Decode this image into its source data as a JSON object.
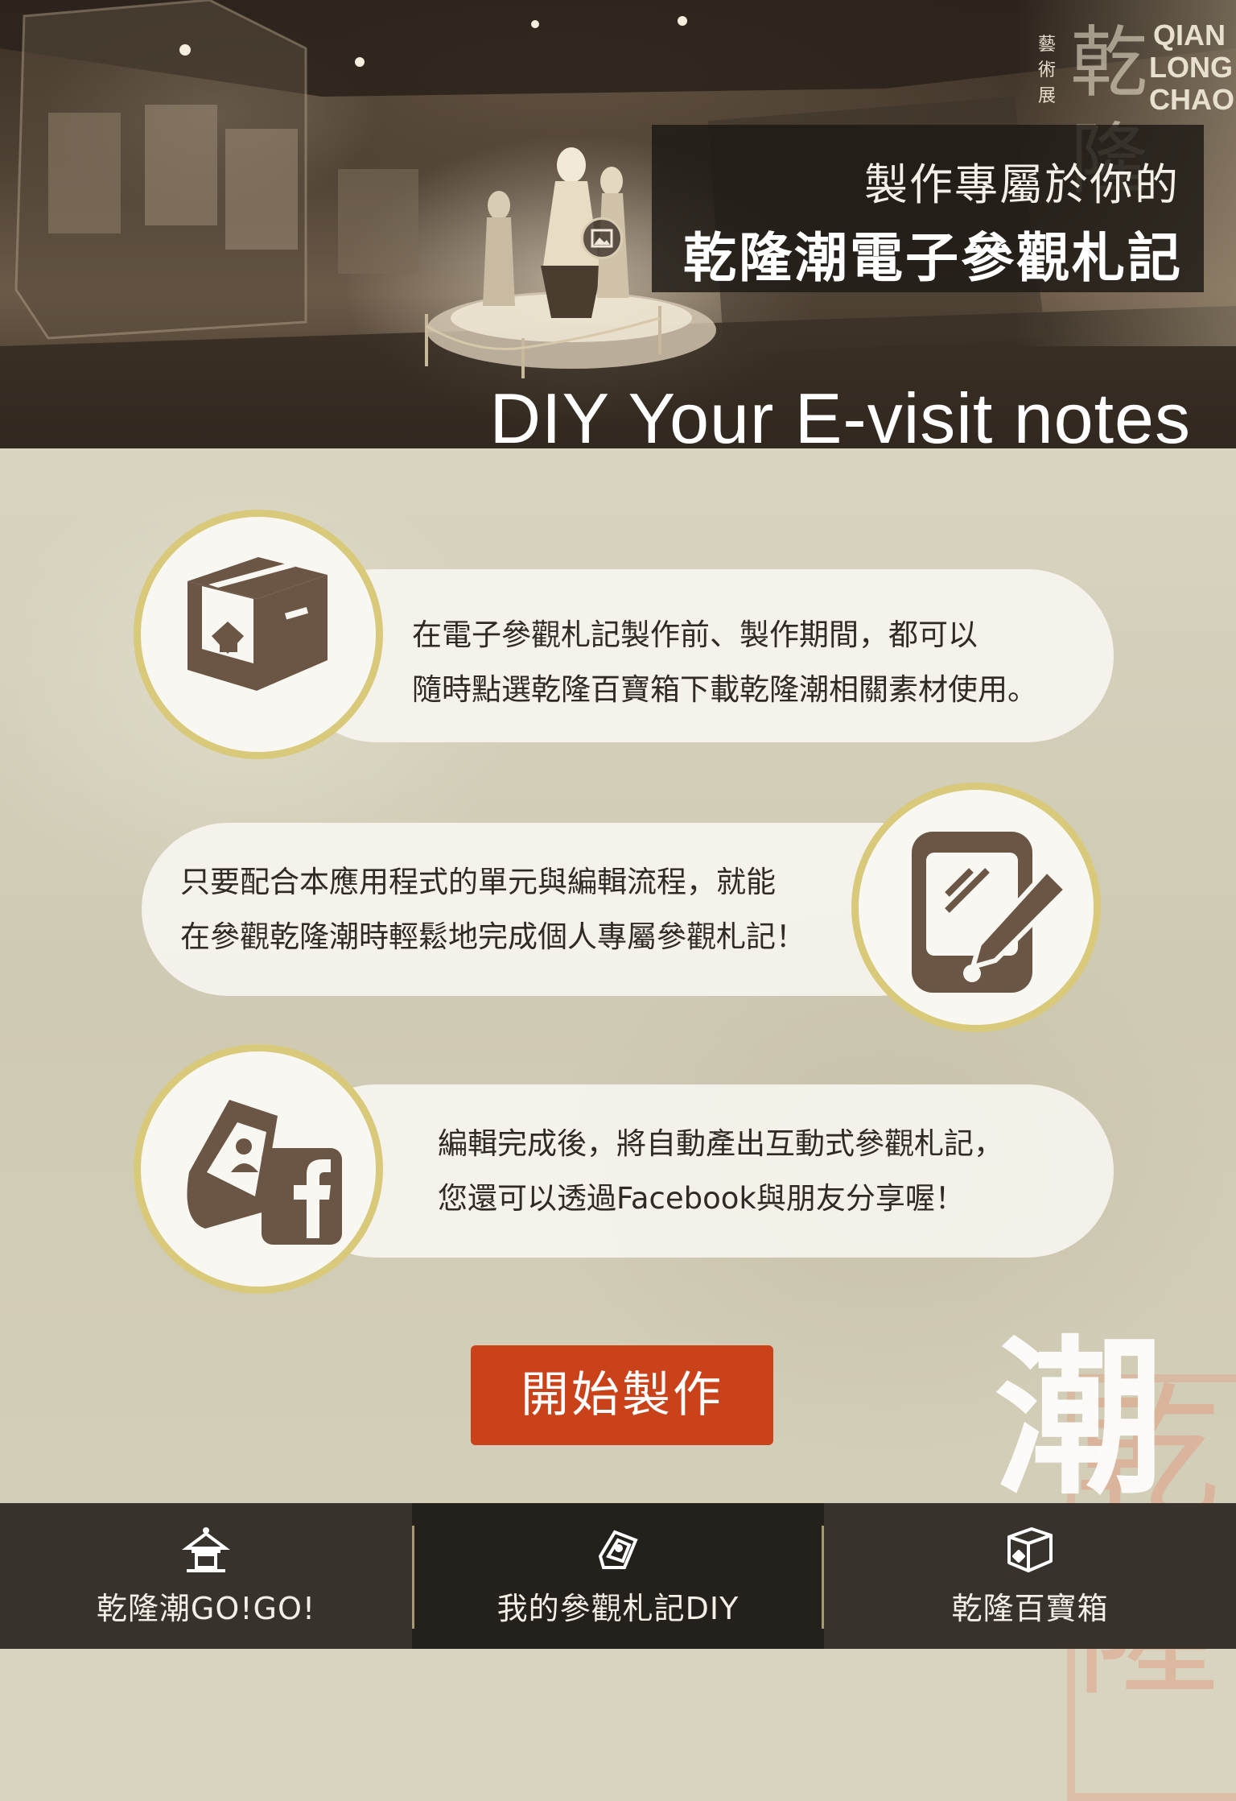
{
  "hero": {
    "subtitle": "製作專屬於你的",
    "title": "乾隆潮電子參觀札記",
    "english_title": "DIY Your E-visit notes",
    "banner_en": "QIAN LONG CHAO",
    "banner_vertical": "藝術展",
    "banner_char_1": "乾",
    "banner_char_2": "隆",
    "photo_icon": "image-icon"
  },
  "steps": [
    {
      "icon": "treasure-box-icon",
      "line1": "在電子參觀札記製作前、製作期間，都可以",
      "line2": "隨時點選乾隆百寶箱下載乾隆潮相關素材使用。"
    },
    {
      "icon": "tablet-edit-icon",
      "line1": "只要配合本應用程式的單元與編輯流程，就能",
      "line2": "在參觀乾隆潮時輕鬆地完成個人專屬參觀札記！"
    },
    {
      "icon": "facebook-share-icon",
      "line1": "編輯完成後，將自動產出互動式參觀札記，",
      "line2": "您還可以透過Facebook與朋友分享喔！"
    }
  ],
  "decoration": {
    "char_1": "乾",
    "char_2": "隆",
    "char_3": "潮"
  },
  "start_button": "開始製作",
  "bottom_nav": [
    {
      "label": "乾隆潮GO!GO!",
      "icon": "pavilion-icon",
      "active": false
    },
    {
      "label": "我的參觀札記DIY",
      "icon": "notebook-icon",
      "active": true
    },
    {
      "label": "乾隆百寶箱",
      "icon": "box-icon",
      "active": false
    }
  ],
  "colors": {
    "accent_button": "#c9421a",
    "circle_border": "#d9c97a",
    "icon_brown": "#6b5645",
    "nav_bg": "#37332c"
  }
}
